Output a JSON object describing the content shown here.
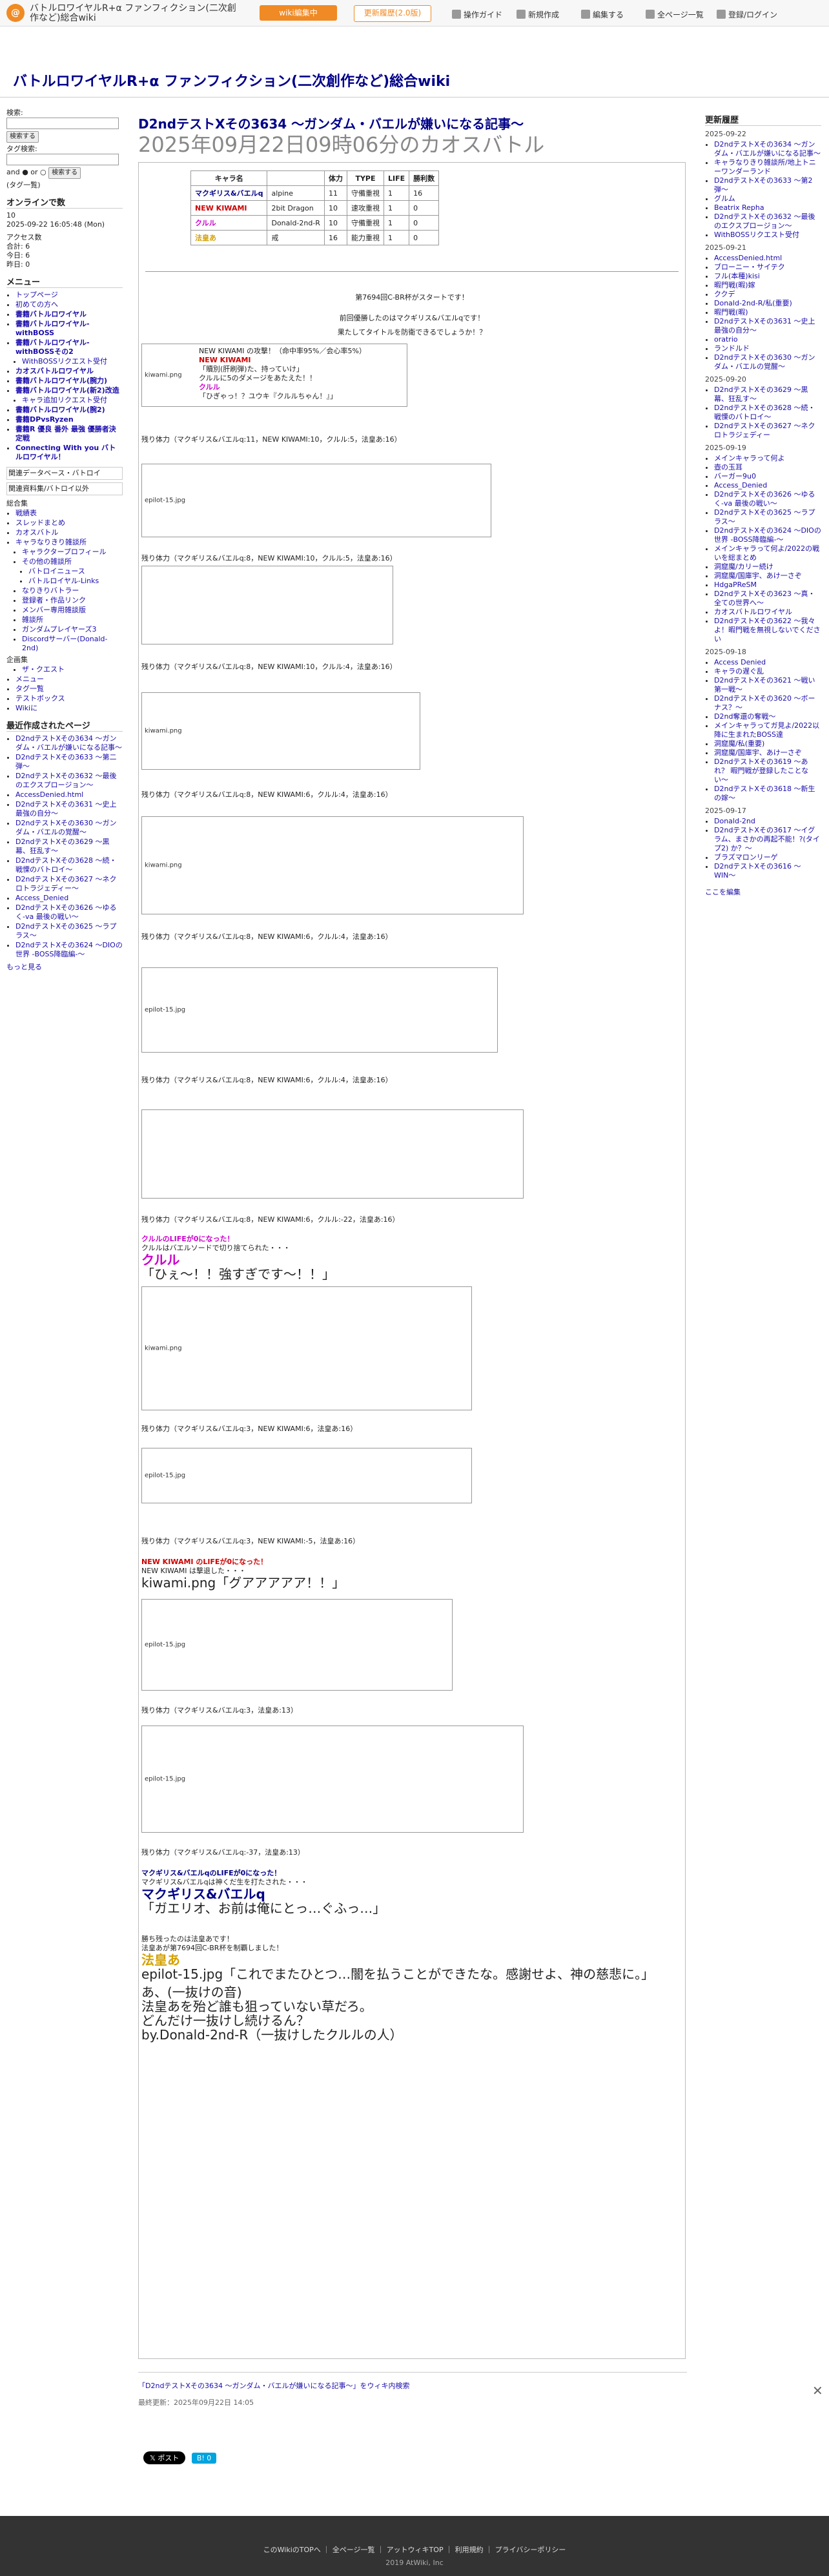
{
  "header": {
    "site_name": "バトルロワイヤルR+α ファンフィクション(二次創作など)総合wiki",
    "edit_btn": "wiki編集中",
    "history_btn": "更新履歴(2.0版)",
    "nav": [
      "操作ガイド",
      "新規作成",
      "編集する",
      "全ページ一覧",
      "登録/ログイン"
    ]
  },
  "site_title": "バトルロワイヤルR+α ファンフィクション(二次創作など)総合wiki",
  "left": {
    "search_label": "検索:",
    "search_btn": "検索する",
    "tag_search_label": "タグ検索:",
    "and_or": "and ● or ○",
    "search_btn2": "検索する",
    "tag_hint": "(タグ一覧)",
    "online_title": "オンラインで数",
    "online_count": "10",
    "online_time": "2025-09-22 16:05:48 (Mon)",
    "access_title": "アクセス数",
    "access_total": "合計: 6",
    "access_today": "今日: 6",
    "access_yesterday": "昨日: 0",
    "menu_title": "メニュー",
    "menu_items": [
      "トップページ",
      "初めての方へ",
      "書籍バトルロワイヤル",
      "書籍バトルロワイヤル-withBOSS",
      "書籍バトルロワイヤル-withBOSSその2",
      "WithBOSSリクエスト受付",
      "カオスバトルロワイヤル",
      "書籍バトルロワイヤル(腕力)",
      "書籍バトルロワイヤル(新2)改造",
      "キャラ追加リクエスト受付",
      "書籍バトルロワイヤル(腕2)",
      "書籍DPvsRyzen",
      "書籍R 優良 番外 最強 優勝者決定戦",
      "Connecting With you バトルロワイヤル！"
    ],
    "links_title": "関連データベース・バトロイ",
    "links2": "関連資料集/バトロイ以外",
    "sub_title": "総合集",
    "sub_items": [
      "戦績表",
      "スレッドまとめ",
      "カオスバトル",
      "キャラなりきり雑談所",
      "キャラクタープロフィール",
      "その他の雑談所",
      "バトロイニュース",
      "バトルロイヤル-Links",
      "なりきりバトラー",
      "登録者・作品リンク",
      "メンバー専用雑談版",
      "雑談所",
      "ガンダムプレイヤーズ3",
      "Discordサーバー(Donald-2nd)"
    ],
    "wiki_title": "企画集",
    "wiki_items": [
      "ザ・クエスト"
    ],
    "tool_items": [
      "メニュー",
      "タグ一覧",
      "テストボックス",
      "Wikiに"
    ],
    "recent_title": "最近作成されたページ",
    "recent_items": [
      "D2ndテストXその3634 〜ガンダム・バエルが嫌いになる記事〜",
      "D2ndテストXその3633 〜第二弾〜",
      "D2ndテストXその3632 〜最後のエクスプロージョン〜",
      "AccessDenied.html",
      "D2ndテストXその3631 〜史上最強の自分〜",
      "D2ndテストXその3630 〜ガンダム・バエルの覚醒〜",
      "D2ndテストXその3629 〜黒幕、狂乱す〜",
      "D2ndテストXその3628 〜続・戦慄のバトロイ〜",
      "D2ndテストXその3627 〜ネクロトラジェディー〜",
      "Access_Denied",
      "D2ndテストXその3626 〜ゆるく-va 最後の戦い〜",
      "D2ndテストXその3625 〜ラプラス〜",
      "D2ndテストXその3624 〜DIOの世界 -BOSS降臨編-〜"
    ],
    "more": "もっと見る"
  },
  "main": {
    "title": "D2ndテストXその3634 〜ガンダム・バエルが嫌いになる記事〜",
    "subtitle": "2025年09月22日09時06分のカオスバトル",
    "table_headers": [
      "キャラ名",
      "",
      "体力",
      "TYPE",
      "LIFE",
      "勝利数"
    ],
    "table_rows": [
      [
        "マクギリス&バエルq",
        "alpine",
        "11",
        "守備重視",
        "1",
        "16"
      ],
      [
        "NEW KIWAMI",
        "2bit Dragon",
        "10",
        "速攻重視",
        "1",
        "0"
      ],
      [
        "クルル",
        "Donald-2nd-R",
        "10",
        "守備重視",
        "1",
        "0"
      ],
      [
        "法皇あ",
        "戒",
        "16",
        "能力重視",
        "1",
        "0"
      ]
    ],
    "intro1": "第7694回C-BR杯がスタートです！",
    "intro2": "前回優勝したのはマクギリス&バエルqです！",
    "intro3": "果たしてタイトルを防衛できるでしょうか！？",
    "hp1": "残り体力（マクギリス&バエルq:11，NEW KIWAMI:10，クルル:5，法皇あ:16）",
    "hp2": "残り体力（マクギリス&バエルq:8，NEW KIWAMI:10，クルル:5，法皇あ:16）",
    "hp3": "残り体力（マクギリス&バエルq:8，NEW KIWAMI:10，クルル:4，法皇あ:16）",
    "hp4": "残り体力（マクギリス&バエルq:8，NEW KIWAMI:6，クルル:4，法皇あ:16）",
    "hp5": "残り体力（マクギリス&バエルq:8，NEW KIWAMI:6，クルル:4，法皇あ:16）",
    "hp6": "残り体力（マクギリス&バエルq:8，NEW KIWAMI:6，クルル:4，法皇あ:16）",
    "hp7": "残り体力（マクギリス&バエルq:8，NEW KIWAMI:6，クルル:-22，法皇あ:16）",
    "hp8": "残り体力（マクギリス&バエルq:3，NEW KIWAMI:6，法皇あ:16）",
    "hp9": "残り体力（マクギリス&バエルq:3，NEW KIWAMI:-5，法皇あ:16）",
    "hp10": "残り体力（マクギリス&バエルq:3，法皇あ:13）",
    "hp11": "残り体力（マクギリス&バエルq:-37，法皇あ:13）",
    "log1_a": "NEW KIWAMI の攻撃！（命中率95%／会心率5%）",
    "log1_b": "NEW KIWAMI",
    "log1_c": "「贖別(肝刷弾)た、持っていけ」",
    "log1_d": "クルルに5のダメージをあたえた！！",
    "log1_e": "クルル",
    "log1_f": "「ひぎゃっ！？ユウキ『クルルちゃん！』」",
    "kurulu_dies1": "クルルのLIFEが0になった！",
    "kurulu_dies2": "クルルはバエルソードで切り捨てられた・・・",
    "kurulu_big": "クルル",
    "kurulu_line": "「ひぇ〜！！強すぎです〜！！」",
    "kiwami_dies1": "NEW KIWAMI のLIFEが0になった！",
    "kiwami_dies2": "NEW KIWAMI は撃退した・・・",
    "kiwami_line": "kiwami.png「グアアアアア！！」",
    "mac_dies1": "マクギリス&バエルqのLIFEが0になった！",
    "mac_dies2": "マクギリス&バエルqは神くだ生を打たされた・・・",
    "mac_big": "マクギリス&バエルq",
    "mac_line": "「ガエリオ、お前は俺にとっ…ぐふっ…」",
    "win1": "勝ち残ったのは法皇あです！",
    "win2": "法皇あが第7694回C-BR杯を制覇しました！",
    "win_big": "法皇あ",
    "win_line": "epilot-15.jpg「これでまたひとつ…闇を払うことができたな。感謝せよ、神の慈悲に。」",
    "after1": "あ、(一抜けの音)",
    "after2": "法皇あを殆ど誰も狙っていない草だろ。",
    "after3": "どんだけ一抜けし続けるん？",
    "after4": "by.Donald-2nd-R（一抜けしたクルルの人）",
    "share_link": "「D2ndテストXその3634 〜ガンダム・バエルが嫌いになる記事〜」をウィキ内検索",
    "last_updated": "最終更新：2025年09月22日 14:05"
  },
  "right": {
    "title": "更新履歴",
    "groups": [
      {
        "date": "2025-09-22",
        "items": [
          "D2ndテストXその3634 〜ガンダム・バエルが嫌いになる記事〜",
          "キャラなりきり雑談所/地上トニーワンダーランド",
          "D2ndテストXその3633 〜第2弾〜",
          "グルム",
          "Beatrix Repha",
          "D2ndテストXその3632 〜最後のエクスプロージョン〜",
          "WithBOSSリクエスト受付"
        ]
      },
      {
        "date": "2025-09-21",
        "items": [
          "AccessDenied.html",
          "ブローニー・サイテク",
          "フル(本種)kisi",
          "暇門戦(暇)嫁",
          "ククデ",
          "Donald-2nd-R/私(重要)",
          "暇門戦(暇)",
          "D2ndテストXその3631 〜史上最強の自分〜",
          "oratrio",
          "ランドルド",
          "D2ndテストXその3630 〜ガンダム・バエルの覚醒〜"
        ]
      },
      {
        "date": "2025-09-20",
        "items": [
          "D2ndテストXその3629 〜黒幕、狂乱す〜",
          "D2ndテストXその3628 〜続・戦慄のバトロイ〜",
          "D2ndテストXその3627 〜ネクロトラジェディー"
        ]
      },
      {
        "date": "2025-09-19",
        "items": [
          "メインキャラって何よ",
          "壺の玉耳",
          "バーガー9u0",
          "Access_Denied",
          "D2ndテストXその3626 〜ゆるく-va 最後の戦い〜",
          "D2ndテストXその3625 〜ラプラス〜",
          "D2ndテストXその3624 〜DIOの世界 -BOSS降臨編-〜",
          "メインキャラって何よ/2022の戦いを総まとめ",
          "洞窟魔/カリー続け",
          "洞窟魔/国庫宇、あけ一さぞ",
          "HdgaPReSM",
          "D2ndテストXその3623 〜真・全ての世界へ〜",
          "カオスバトルロワイヤル",
          "D2ndテストXその3622 〜我々よ！暇門戦を無視しないでください"
        ]
      },
      {
        "date": "2025-09-18",
        "items": [
          "Access Denied",
          "キャラの遅ぐ乱",
          "D2ndテストXその3621 〜戦い第一戦〜",
          "D2ndテストXその3620 〜ボーナス？〜",
          "D2nd奪還の奪戦〜",
          "メインキャラってガ見よ/2022以降に生まれたBOSS達",
          "洞窟魔/私(重要)",
          "洞窟魔/国庫宇、あけ一さぞ",
          "D2ndテストXその3619 〜あれ？ 暇門戦が登録したことない〜",
          "D2ndテストXその3618 〜新生の嫁〜"
        ]
      },
      {
        "date": "2025-09-17",
        "items": [
          "Donald-2nd",
          "D2ndテストXその3617 〜イグラム、まさかの再起不能！?(タイプ2) か？〜",
          "ブラズマロンリーゲ",
          "D2ndテストXその3616 〜WIN〜"
        ]
      }
    ],
    "edit_here": "ここを編集"
  },
  "footer": {
    "links": [
      "このWikiのTOPへ",
      "全ページ一覧",
      "アットウィキTOP",
      "利用規約",
      "プライバシーポリシー"
    ],
    "copyright": "2019 AtWiki, Inc"
  },
  "share": {
    "post": "ポスト",
    "like": "B! 0"
  }
}
